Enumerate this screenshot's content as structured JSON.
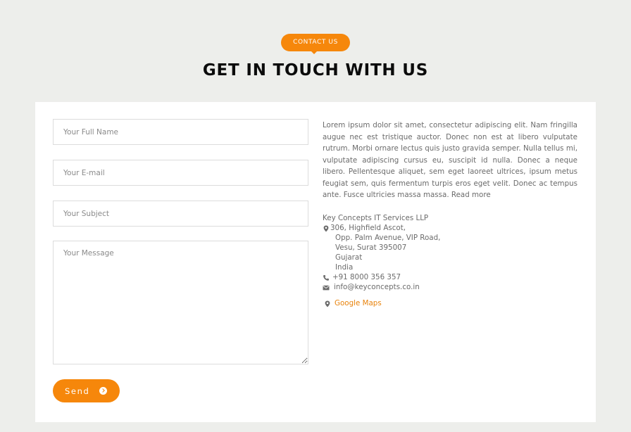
{
  "section": {
    "eyebrow": "CONTACT US",
    "title": "GET IN TOUCH WITH US"
  },
  "form": {
    "name_placeholder": "Your Full Name",
    "email_placeholder": "Your E-mail",
    "subject_placeholder": "Your Subject",
    "message_placeholder": "Your Message",
    "send_label": "Send"
  },
  "about": {
    "text": "Lorem ipsum dolor sit amet, consectetur adipiscing elit. Nam fringilla augue nec est tristique auctor. Donec non est at libero vulputate rutrum. Morbi ornare lectus quis justo gravida semper. Nulla tellus mi, vulputate adipiscing cursus eu, suscipit id nulla. Donec a neque libero. Pellentesque aliquet, sem eget laoreet ultrices, ipsum metus feugiat sem, quis fermentum turpis eros eget velit. Donec ac tempus ante. Fusce ultricies massa massa.",
    "read_more": "Read more"
  },
  "contact": {
    "company": "Key Concepts IT Services LLP",
    "address_lines": [
      "306, Highfield Ascot,",
      "Opp. Palm Avenue, VIP Road,",
      "Vesu, Surat 395007",
      "Gujarat",
      "India"
    ],
    "phone": "+91 8000 356 357",
    "email": "info@keyconcepts.co.in",
    "maps_label": "Google Maps"
  },
  "icons": {
    "pin": "map-marker-icon",
    "phone": "phone-icon",
    "email": "envelope-icon",
    "send": "chevron-circle-right-icon"
  },
  "colors": {
    "accent": "#f6870b",
    "background": "#edeeeb",
    "card": "#ffffff"
  }
}
